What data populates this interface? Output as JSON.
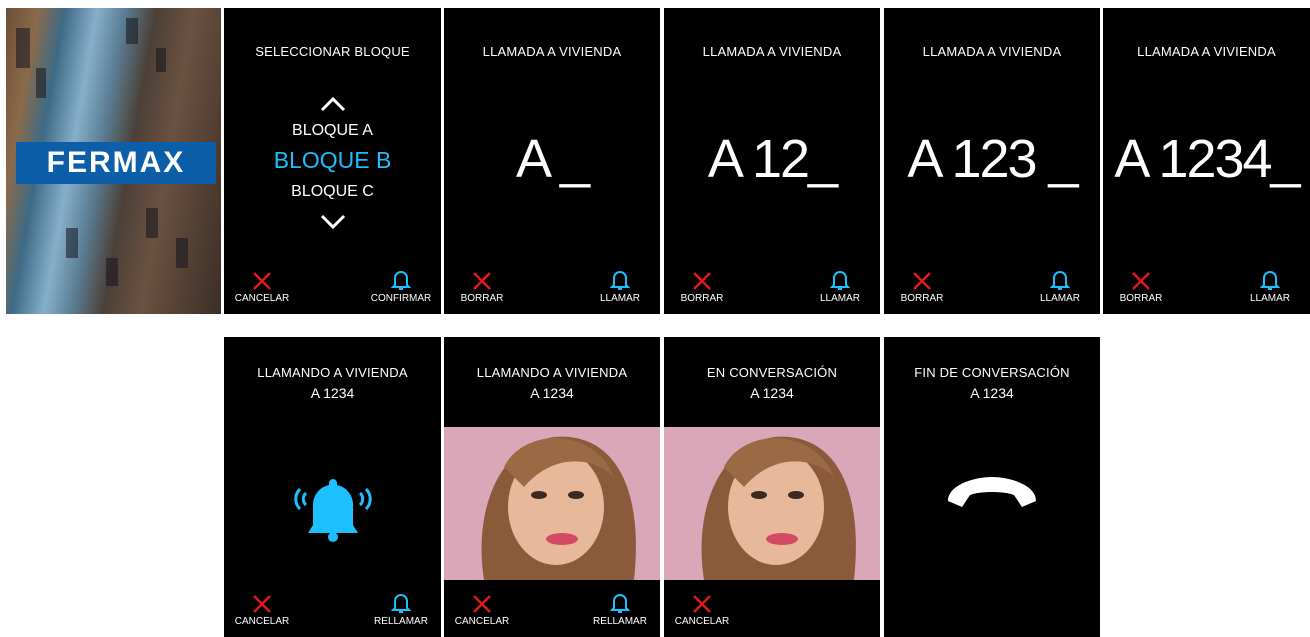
{
  "brand": {
    "logo": "FERMAX"
  },
  "colors": {
    "accent": "#1cbfff",
    "cancel": "#e0191f",
    "background": "#000000"
  },
  "icons": {
    "cancel": "x-icon",
    "confirm": "bell-icon",
    "up": "chevron-up-icon",
    "down": "chevron-down-icon",
    "ringing": "ringing-bell-icon",
    "hangup": "phone-hangup-icon"
  },
  "screens": {
    "select_block": {
      "title": "SELECCIONAR BLOQUE",
      "items": [
        "BLOQUE A",
        "BLOQUE B",
        "BLOQUE C"
      ],
      "selected": "BLOQUE B",
      "left_label": "CANCELAR",
      "right_label": "CONFIRMAR"
    },
    "dial_1": {
      "title": "LLAMADA A VIVIENDA",
      "code": "A _",
      "left_label": "BORRAR",
      "right_label": "LLAMAR"
    },
    "dial_2": {
      "title": "LLAMADA A VIVIENDA",
      "code": "A 12_",
      "left_label": "BORRAR",
      "right_label": "LLAMAR"
    },
    "dial_3": {
      "title": "LLAMADA A VIVIENDA",
      "code": "A 123 _",
      "left_label": "BORRAR",
      "right_label": "LLAMAR"
    },
    "dial_4": {
      "title": "LLAMADA A VIVIENDA",
      "code": "A 1234_",
      "left_label": "BORRAR",
      "right_label": "LLAMAR"
    },
    "calling": {
      "title": "LLAMANDO A VIVIENDA",
      "sub": "A 1234",
      "left_label": "CANCELAR",
      "right_label": "RELLAMAR"
    },
    "calling_video": {
      "title": "LLAMANDO A VIVIENDA",
      "sub": "A 1234",
      "left_label": "CANCELAR",
      "right_label": "RELLAMAR"
    },
    "conversation": {
      "title": "EN CONVERSACIÓN",
      "sub": "A 1234",
      "left_label": "CANCELAR"
    },
    "end": {
      "title": "FIN DE CONVERSACIÓN",
      "sub": "A 1234"
    }
  }
}
